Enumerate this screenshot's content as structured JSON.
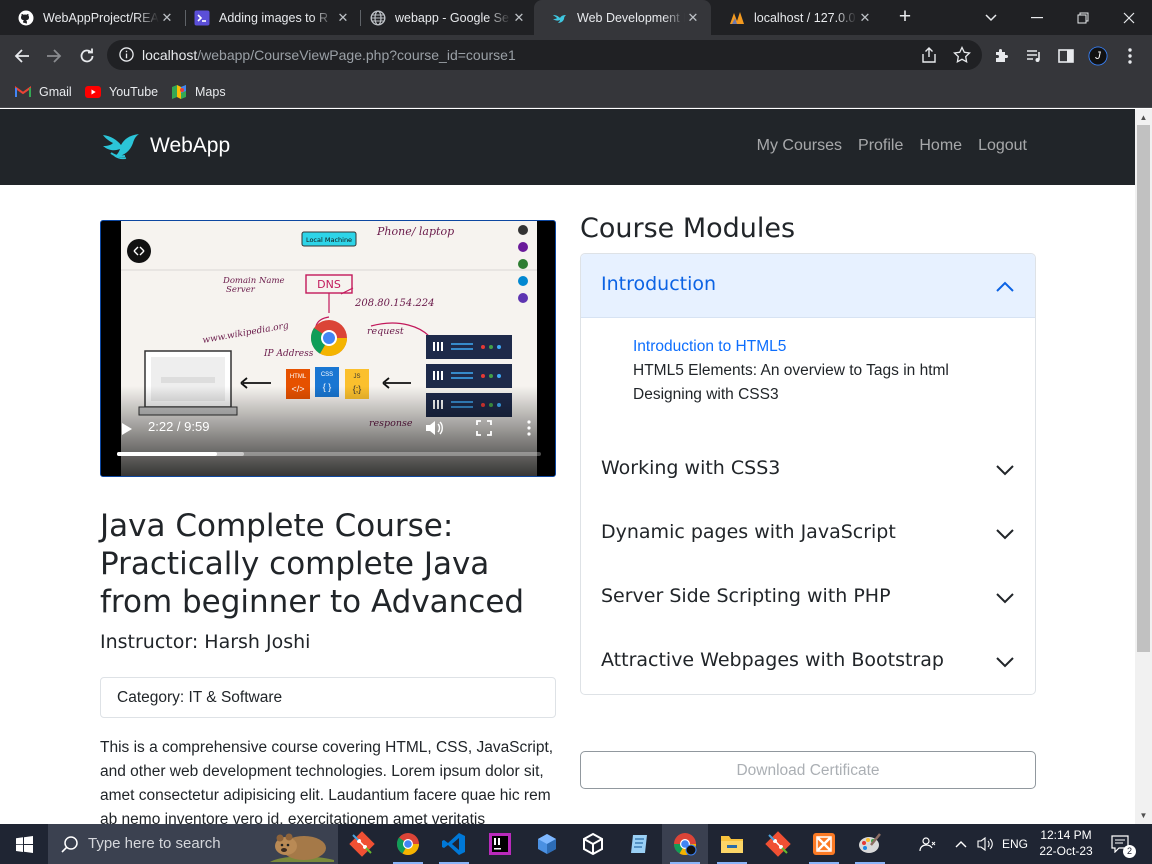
{
  "browser": {
    "tabs": [
      {
        "title": "WebAppProject/REA",
        "icon": "github-icon"
      },
      {
        "title": "Adding images to R",
        "icon": "terminal-icon"
      },
      {
        "title": "webapp - Google Se",
        "icon": "globe-icon"
      },
      {
        "title": "Web Development B",
        "icon": "webapp-bird-icon"
      },
      {
        "title": "localhost / 127.0.0.1",
        "icon": "phpmyadmin-icon"
      }
    ],
    "active_tab_index": 3,
    "url_host": "localhost",
    "url_path": "/webapp/CourseViewPage.php?course_id=course1",
    "bookmarks": [
      {
        "label": "Gmail",
        "icon": "gmail-icon"
      },
      {
        "label": "YouTube",
        "icon": "youtube-icon"
      },
      {
        "label": "Maps",
        "icon": "maps-icon"
      }
    ],
    "profile_initial": "J"
  },
  "site": {
    "brand": "WebApp",
    "nav": [
      "My Courses",
      "Profile",
      "Home",
      "Logout"
    ]
  },
  "video": {
    "time": "2:22 / 9:59",
    "played_fraction": 0.237,
    "board_labels": {
      "local_machine": "Local Machine",
      "phone": "Phone/ laptop",
      "domain_name": "Domain Name",
      "server": "Server",
      "dns": "DNS",
      "ip": "208.80.154.224",
      "website": "www.wikipedia.org",
      "ip_address": "IP Address",
      "request": "request",
      "response": "response",
      "html": "HTML",
      "css": "CSS",
      "js": "JS"
    }
  },
  "course": {
    "title": "Java Complete Course: Practically complete Java from beginner to Advanced",
    "instructor": "Instructor: Harsh Joshi",
    "category": "Category: IT & Software",
    "description": "This is a comprehensive course covering HTML, CSS, JavaScript, and other web development technologies. Lorem ipsum dolor sit, amet consectetur adipisicing elit. Laudantium facere quae hic rem ab nemo inventore vero id, exercitationem amet veritatis"
  },
  "modules": {
    "heading": "Course Modules",
    "items": [
      {
        "title": "Introduction",
        "expanded": true,
        "lessons": [
          "Introduction to HTML5",
          "HTML5 Elements: An overview to Tags in html",
          "Designing with CSS3"
        ]
      },
      {
        "title": "Working with CSS3",
        "expanded": false
      },
      {
        "title": "Dynamic pages with JavaScript",
        "expanded": false
      },
      {
        "title": "Server Side Scripting with PHP",
        "expanded": false
      },
      {
        "title": "Attractive Webpages with Bootstrap",
        "expanded": false
      }
    ],
    "certificate_button": "Download Certificate"
  },
  "taskbar": {
    "search_placeholder": "Type here to search",
    "apps": [
      "git-icon",
      "chrome-icon",
      "vscode-icon",
      "intellij-icon",
      "box-icon",
      "unity-icon",
      "notepad-icon",
      "chrome-profile-icon",
      "file-explorer-icon",
      "git-gui-icon",
      "xampp-icon",
      "paint-icon"
    ],
    "language": "ENG",
    "time": "12:14 PM",
    "date": "22-Oct-23",
    "notification_count": "2"
  },
  "colors": {
    "accent": "#0d6efd",
    "accordion_open": "#0c63e4",
    "brand_bird": "#2bc5d8",
    "navbar": "#212529"
  }
}
